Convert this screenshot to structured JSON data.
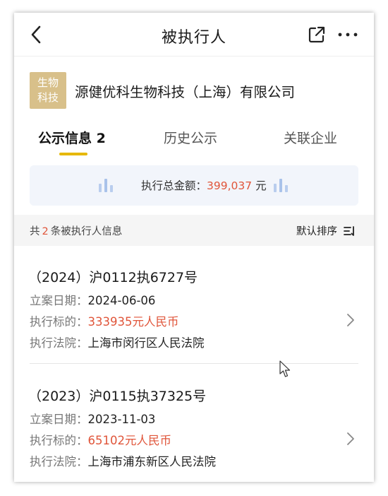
{
  "nav": {
    "title": "被执行人",
    "back_icon": "chevron-left-icon",
    "share_icon": "share-icon",
    "more_icon": "more-dots-icon"
  },
  "company": {
    "badge_line1": "生物",
    "badge_line2": "科技",
    "badge_color": "#d8c08a",
    "name": "源健优科生物科技（上海）有限公司"
  },
  "tabs": [
    {
      "label": "公示信息 2",
      "active": true
    },
    {
      "label": "历史公示",
      "active": false
    },
    {
      "label": "关联企业",
      "active": false
    }
  ],
  "summary": {
    "label": "执行总金额：",
    "value": "399,037",
    "unit": "元"
  },
  "list_header": {
    "prefix": "共",
    "count": "2",
    "suffix": "条被执行人信息",
    "sort_label": "默认排序"
  },
  "records": [
    {
      "case_no": "（2024）沪0112执6727号",
      "date_label": "立案日期：",
      "date": "2024-06-06",
      "target_label": "执行标的：",
      "target": "333935元人民币",
      "court_label": "执行法院：",
      "court": "上海市闵行区人民法院"
    },
    {
      "case_no": "（2023）沪0115执37325号",
      "date_label": "立案日期：",
      "date": "2023-11-03",
      "target_label": "执行标的：",
      "target": "65102元人民币",
      "court_label": "执行法院：",
      "court": "上海市浦东新区人民法院"
    }
  ],
  "colors": {
    "accent_red": "#e0553a",
    "tab_indicator": "#e6b800",
    "summary_bg": "#f2f5fb",
    "bar_icon": "#a9c2ea"
  }
}
